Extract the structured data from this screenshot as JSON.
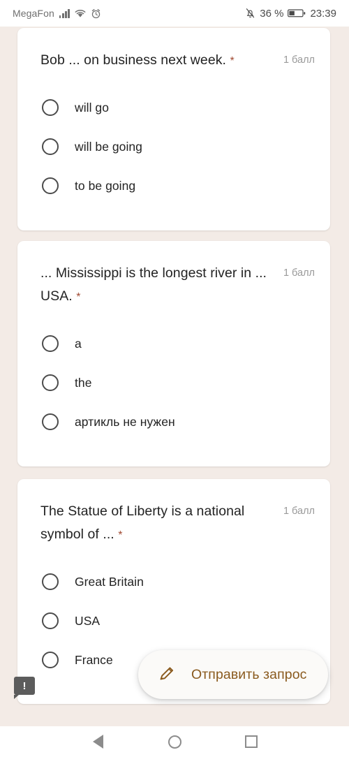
{
  "statusbar": {
    "carrier": "MegaFon",
    "signal_icon": "signal-bars-icon",
    "wifi_icon": "wifi-icon",
    "alarm_icon": "alarm-clock-icon",
    "mute_icon": "bell-muted-icon",
    "battery_percent": "36 %",
    "battery_icon": "battery-icon",
    "time": "23:39"
  },
  "quiz": {
    "required_marker": "*",
    "cards": [
      {
        "question": "Bob ... on business next week.",
        "points": "1 балл",
        "options": [
          "will go",
          "will be going",
          "to be going"
        ]
      },
      {
        "question": "... Mississippi is the longest river in ... USA.",
        "points": "1 балл",
        "options": [
          "a",
          "the",
          "артикль не нужен"
        ]
      },
      {
        "question": "The Statue of Liberty is a national symbol of ...",
        "points": "1 балл",
        "options": [
          "Great Britain",
          "USA",
          "France"
        ]
      }
    ]
  },
  "fab": {
    "label": "Отправить запрос",
    "icon": "pencil-icon"
  },
  "hint_badge": {
    "icon": "callout-exclamation-icon",
    "glyph": "!"
  },
  "navbar": {
    "back": "back-triangle-icon",
    "home": "home-circle-icon",
    "recents": "recents-square-icon"
  },
  "colors": {
    "page_background": "#f3ebe6",
    "card_background": "#ffffff",
    "required_asterisk": "#a14a32",
    "points_text": "#9a9a9a",
    "fab_text": "#8a5a1e",
    "body_text": "#232323"
  }
}
